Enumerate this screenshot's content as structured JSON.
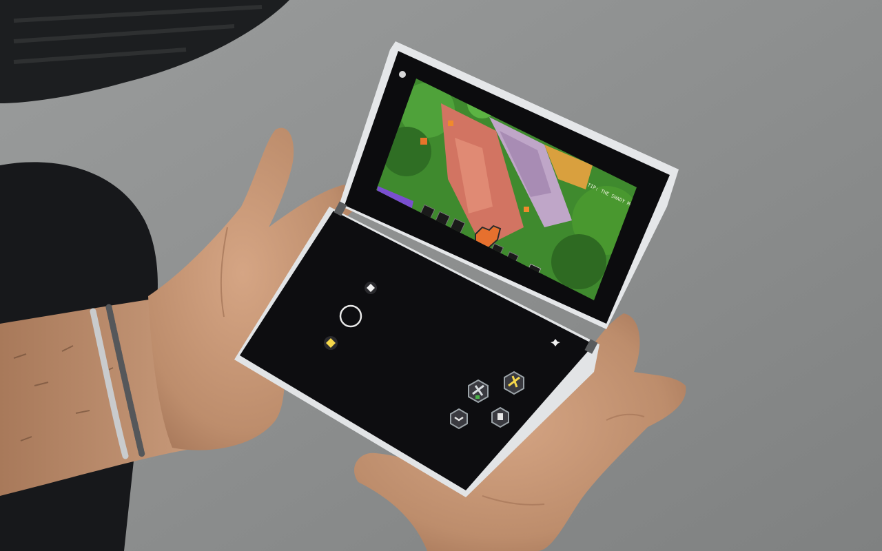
{
  "scene": {
    "description_free": true,
    "device": "dual-screen handheld",
    "game_hud": {
      "top_right_text": "TIP: THE SHADY MOLE",
      "hotbar_slots": 5,
      "health_level": 0.75
    },
    "touch_controls": {
      "buttons": [
        {
          "name": "joystick",
          "icon": "ring-icon"
        },
        {
          "name": "gem-button-top",
          "icon": "gem-icon"
        },
        {
          "name": "gem-button-left",
          "icon": "gem-icon"
        },
        {
          "name": "sparkle-button",
          "icon": "sparkle-icon"
        },
        {
          "name": "melee-attack-button",
          "icon": "sword-icon"
        },
        {
          "name": "ranged-attack-button",
          "icon": "bow-icon"
        },
        {
          "name": "roll-button",
          "icon": "roll-icon"
        },
        {
          "name": "potion-button",
          "icon": "potion-icon"
        }
      ]
    },
    "colors": {
      "floor": "#8e9090",
      "screen_bezel": "#0c0c0e",
      "device_shell": "#e4e6e8",
      "skin": "#c59676",
      "grass": "#3f8a2e",
      "path": "#d27462",
      "stone": "#bfa6c8",
      "sand": "#d9a03e",
      "button_accent": "#f5d74b"
    }
  }
}
